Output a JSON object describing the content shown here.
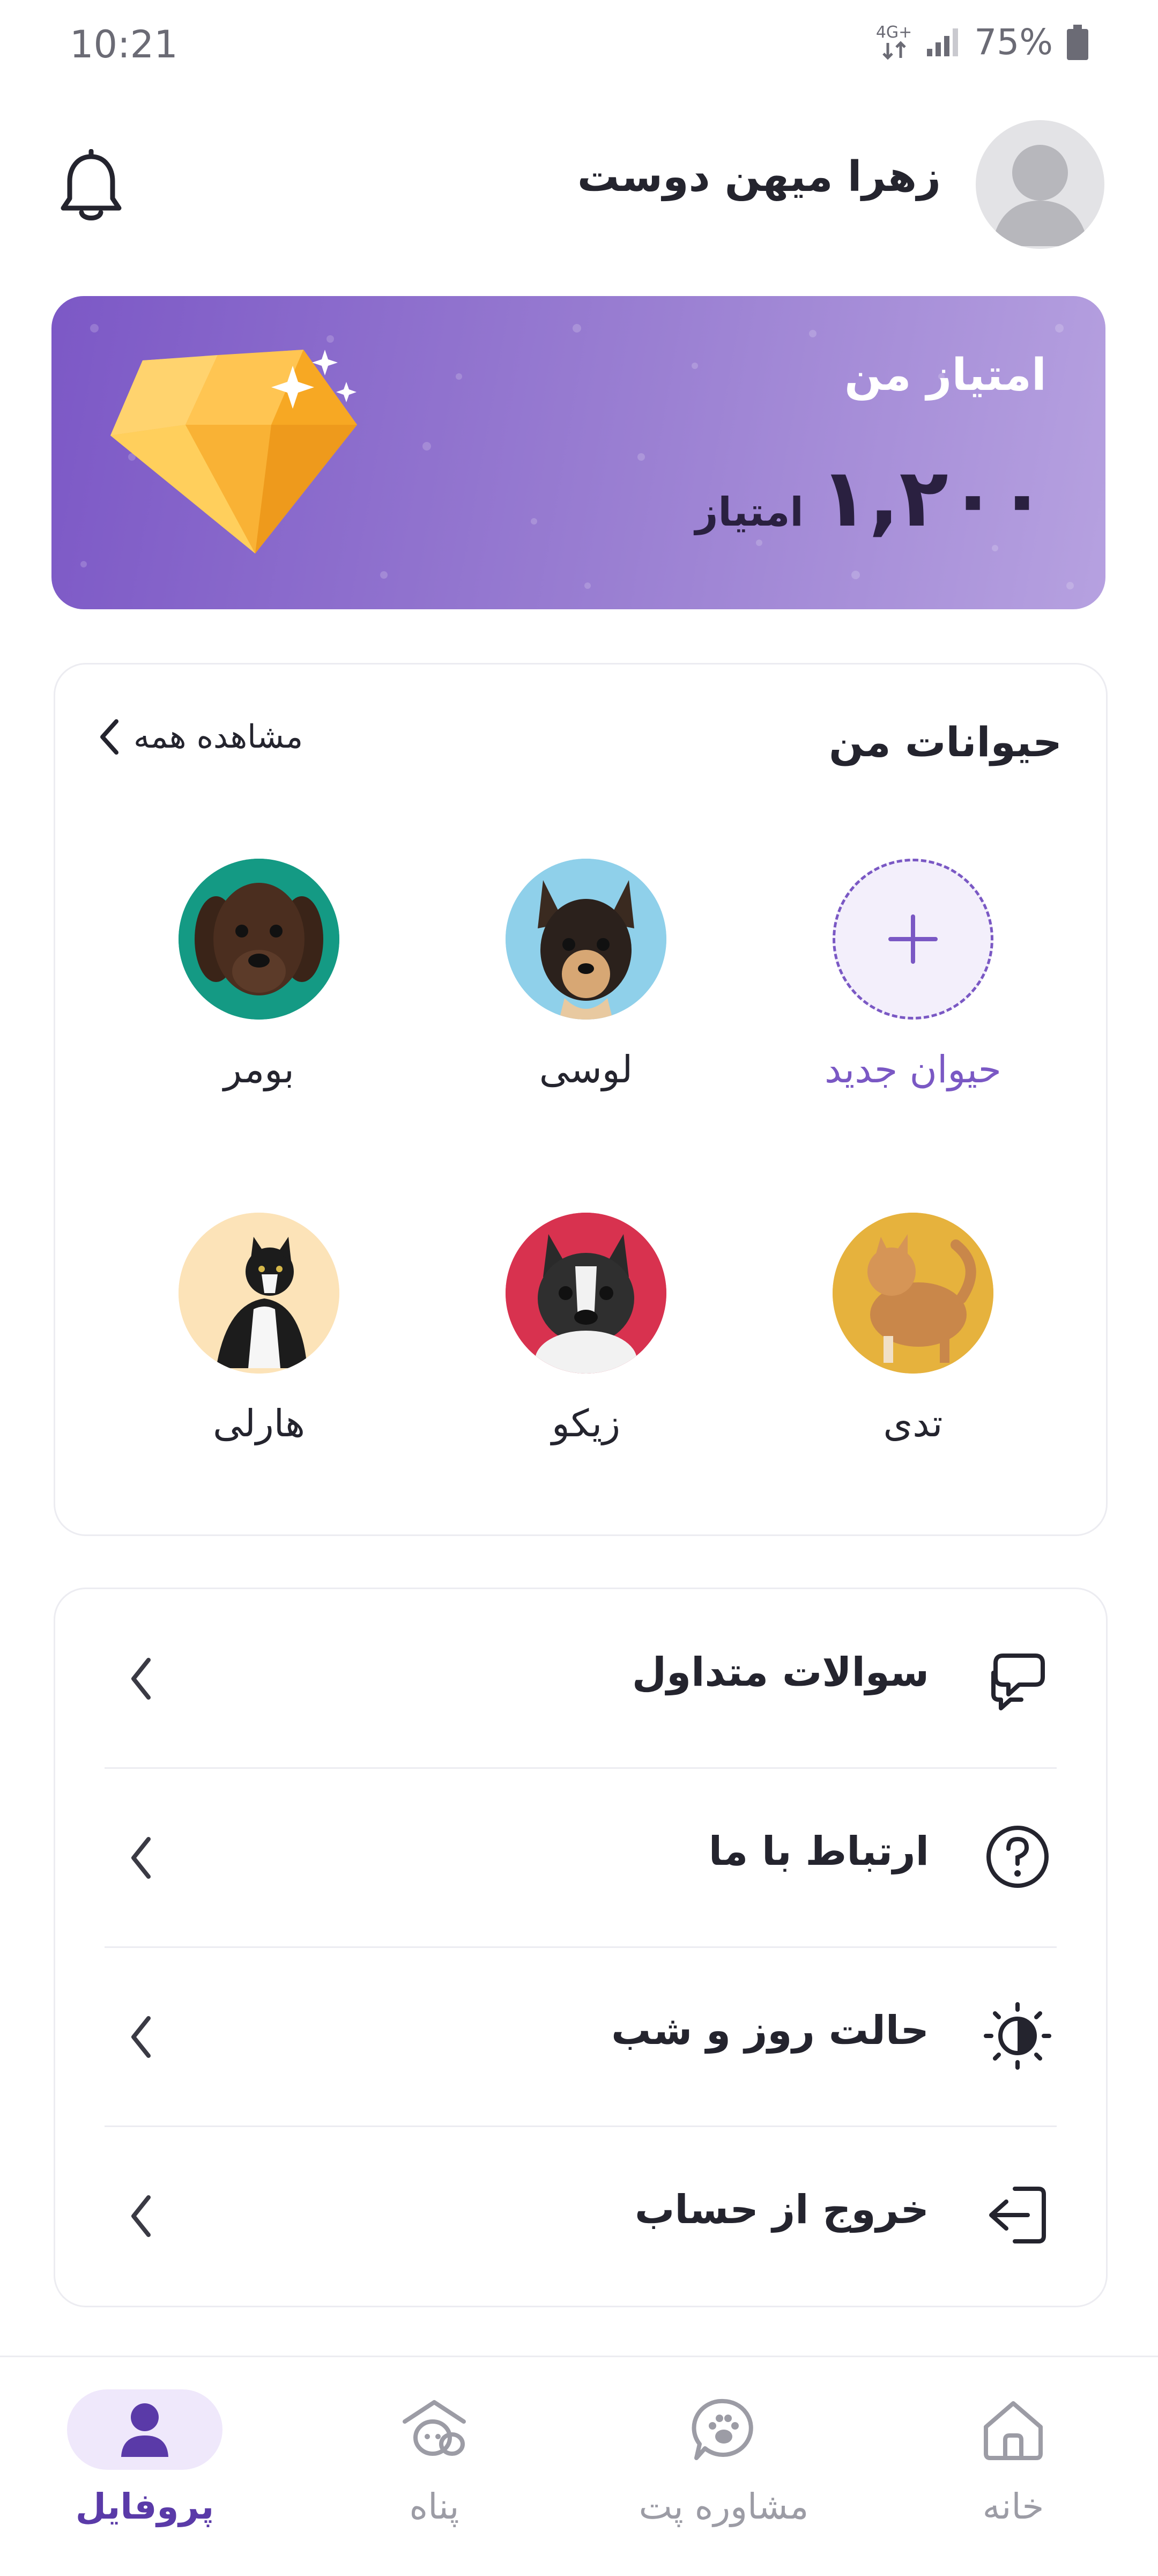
{
  "status_bar": {
    "time": "10:21",
    "network": "4G+",
    "battery": "75%"
  },
  "header": {
    "user_name": "زهرا میهن دوست"
  },
  "points": {
    "title": "امتیاز من",
    "value": "۱,۲۰۰",
    "unit": "امتیاز"
  },
  "pets": {
    "title": "حیوانات من",
    "see_all": "مشاهده همه",
    "add_label": "حیوان جدید",
    "items": [
      {
        "name": "لوسی"
      },
      {
        "name": "بومر"
      },
      {
        "name": "تدی"
      },
      {
        "name": "زیکو"
      },
      {
        "name": "هارلی"
      }
    ]
  },
  "menu": {
    "items": [
      {
        "label": "سوالات متداول",
        "icon": "chat-bubbles-icon"
      },
      {
        "label": "ارتباط با ما",
        "icon": "question-circle-icon"
      },
      {
        "label": "حالت روز و شب",
        "icon": "brightness-icon"
      },
      {
        "label": "خروج از حساب",
        "icon": "logout-icon"
      }
    ]
  },
  "nav": {
    "items": [
      {
        "label": "پروفایل",
        "icon": "profile-icon",
        "active": true
      },
      {
        "label": "پناه",
        "icon": "shelter-icon"
      },
      {
        "label": "مشاوره پت",
        "icon": "pet-consult-icon"
      },
      {
        "label": "خانه",
        "icon": "home-icon"
      }
    ]
  },
  "colors": {
    "accent": "#7a58c4",
    "nav_active": "#5a3aa8",
    "card_gradient_start": "#7c58c6",
    "card_gradient_end": "#b6a1e0"
  }
}
